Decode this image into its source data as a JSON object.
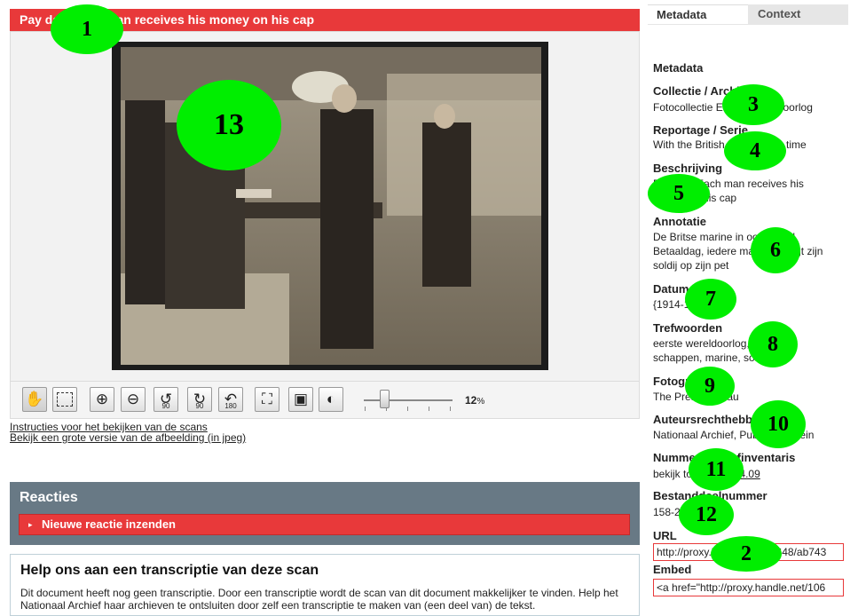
{
  "title_bar": {
    "title": "Pay day. Each man receives his money on his cap"
  },
  "viewer": {
    "zoom_value": "12",
    "zoom_unit": "%",
    "links": [
      "Instructies voor het bekijken van de scans",
      "Bekijk een grote versie van de afbeelding (in jpeg)"
    ],
    "tools": [
      {
        "name": "pan",
        "icon": "hand-icon",
        "glyph": "✋"
      },
      {
        "name": "select",
        "icon": "marquee-icon",
        "glyph": ""
      },
      {
        "name": "zoom-in",
        "icon": "zoom-in-icon",
        "glyph": "⊕"
      },
      {
        "name": "zoom-out",
        "icon": "zoom-out-icon",
        "glyph": "⊖"
      },
      {
        "name": "rotate-left",
        "icon": "rotate-left-icon",
        "glyph": "↺",
        "label": "90"
      },
      {
        "name": "rotate-right",
        "icon": "rotate-right-icon",
        "glyph": "↻",
        "label": "90"
      },
      {
        "name": "rotate-180",
        "icon": "rotate-180-icon",
        "glyph": "↶",
        "label": "180"
      },
      {
        "name": "fit",
        "icon": "fit-screen-icon",
        "glyph": "⛶"
      },
      {
        "name": "full",
        "icon": "fullsize-icon",
        "glyph": "▣"
      },
      {
        "name": "contrast",
        "icon": "contrast-icon",
        "glyph": "◐"
      }
    ]
  },
  "reacties": {
    "title": "Reacties",
    "new_button": "Nieuwe reactie inzenden"
  },
  "transcript": {
    "title": "Help ons aan een transcriptie van deze scan",
    "text": "Dit document heeft nog geen transcriptie. Door een transcriptie wordt de scan van dit document makkelijker te vinden. Help het Nationaal Archief haar archieven te ontsluiten door zelf een transcriptie te maken van (een deel van) de tekst."
  },
  "tabs": {
    "metadata": "Metadata",
    "context": "Context"
  },
  "metadata": {
    "heading": "Metadata",
    "fields": [
      {
        "label": "Collectie / Archief",
        "value": "Fotocollectie Eerste Wereldoorlog"
      },
      {
        "label": "Reportage / Serie",
        "value": "With the British Navy in war time"
      },
      {
        "label": "Beschrijving",
        "value": "Pay day. Each man receives his money on his cap"
      },
      {
        "label": "Annotatie",
        "value": "De Britse marine in oorlogstijd. Betaaldag, iedere man ontvangt zijn soldij op zijn pet"
      },
      {
        "label": "Datum",
        "value": "{1914-1918}"
      },
      {
        "label": "Trefwoorden",
        "value": "eerste wereldoorlog, schepen, schappen, marine, soldij"
      },
      {
        "label": "Fotograaf",
        "value": "The Press Bureau"
      },
      {
        "label": "Auteursrechthebbende",
        "value": "Nationaal Archief, Publiek Domein"
      },
      {
        "label": "Nummer archiefinventaris",
        "value_prefix": "bekijk toegang ",
        "value_link": "2.24.09"
      },
      {
        "label": "Bestanddeelnummer",
        "value": "158-2648"
      }
    ],
    "url_label": "URL",
    "url_value": "http://proxy.handle.net/10648/ab743",
    "embed_label": "Embed",
    "embed_value": "<a href=\"http://proxy.handle.net/106"
  },
  "markers": [
    "1",
    "2",
    "3",
    "4",
    "5",
    "6",
    "7",
    "8",
    "9",
    "10",
    "11",
    "12",
    "13"
  ],
  "colors": {
    "accent_red": "#e8393a",
    "reacties_bg": "#687985",
    "marker_green": "#00ee00"
  }
}
